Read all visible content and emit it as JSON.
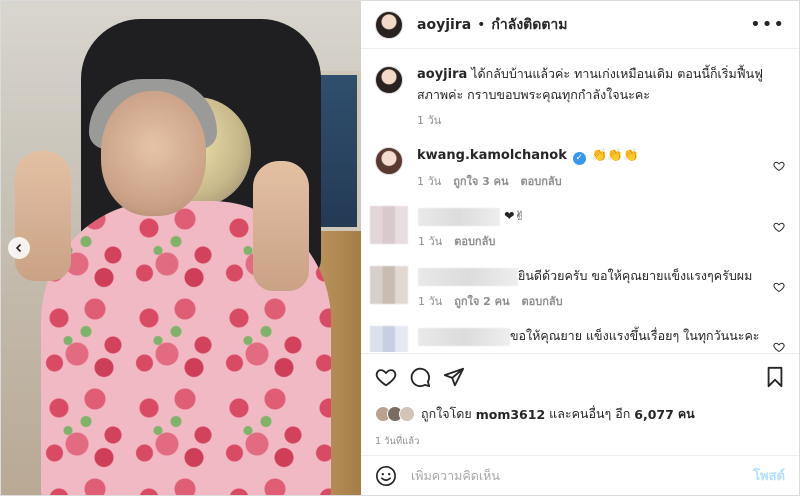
{
  "post": {
    "username": "aoyjira",
    "dot": "•",
    "follow_status": "กำลังติดตาม",
    "more_label": "•••"
  },
  "caption": {
    "username": "aoyjira",
    "text": " ได้กลับบ้านแล้วค่ะ ทานเก่งเหมือนเดิม ตอนนี้ก็เริ่มฟื้นฟูสภาพค่ะ กราบขอบพระคุณทุกกำลังใจนะคะ",
    "time": "1 วัน"
  },
  "comments": [
    {
      "username": "kwang.kamolchanok",
      "verified_mark": "✓",
      "text": "👏👏👏",
      "time": "1 วัน",
      "likes": "ถูกใจ 3 คน",
      "reply": "ตอบกลับ"
    },
    {
      "text": "❤✌",
      "time": "1 วัน",
      "reply": "ตอบกลับ"
    },
    {
      "text": "ยินดีด้วยครับ ขอให้คุณยายแข็งแรงๆครับผม",
      "time": "1 วัน",
      "likes": "ถูกใจ 2 คน",
      "reply": "ตอบกลับ"
    },
    {
      "text": "ขอให้คุณยาย แข็งแรงขึ้นเรื่อยๆ ในทุกวันนะคะ❤",
      "text2": "❤"
    }
  ],
  "likes": {
    "prefix": "ถูกใจโดย",
    "user": "mom3612",
    "middle": "และคนอื่นๆ อีก",
    "count": "6,077",
    "suffix": "คน"
  },
  "timestamp": "1 วันที่แล้ว",
  "composer": {
    "placeholder": "เพิ่มความคิดเห็น",
    "post_label": "โพสต์"
  },
  "colors": {
    "link_blue": "#3897f0",
    "post_disabled": "#b2dffc",
    "muted": "#8e8e8e",
    "heart_red": "#ed4956"
  }
}
